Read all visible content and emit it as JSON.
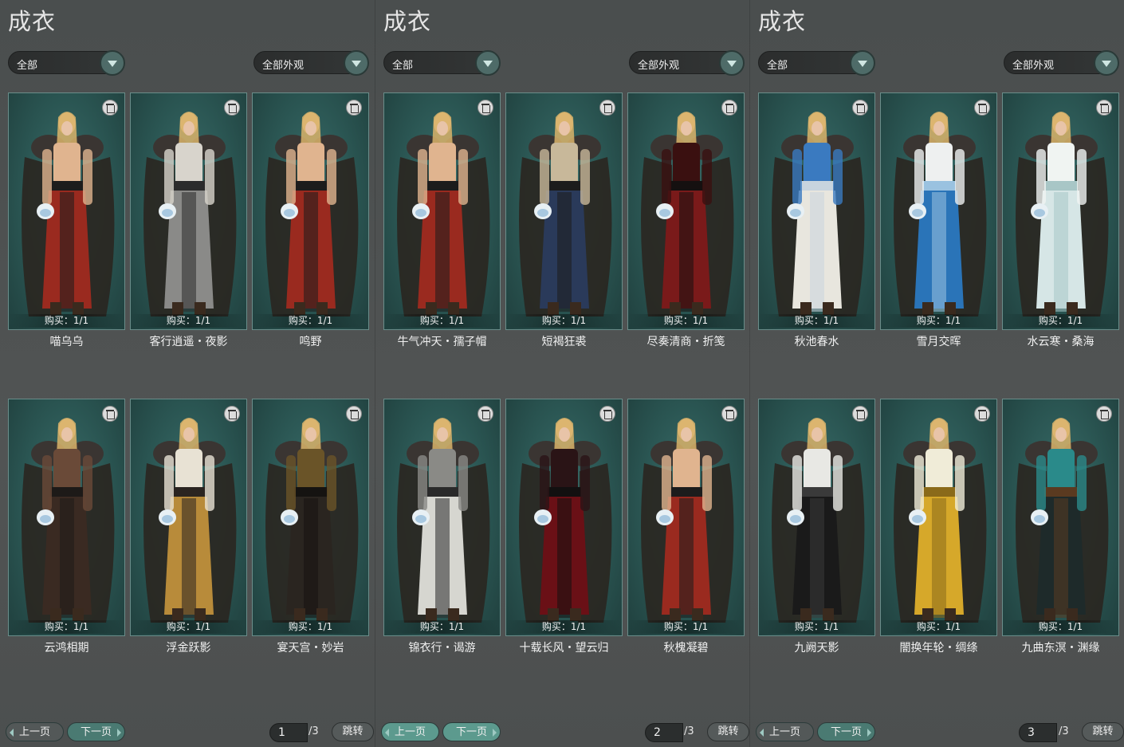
{
  "panels": [
    {
      "title": "成衣",
      "filter_category": "全部",
      "filter_appearance": "全部外观",
      "items": [
        {
          "name": "喵乌乌",
          "buy": "购买：1/1",
          "palette": [
            "#9a2a1f",
            "#e0b48f",
            "#1c1c1c"
          ]
        },
        {
          "name": "客行逍遥・夜影",
          "buy": "购买：1/1",
          "palette": [
            "#8a8a88",
            "#d8d4cc",
            "#2b2b2b"
          ]
        },
        {
          "name": "鸣野",
          "buy": "购买：1/1",
          "palette": [
            "#9a2a1f",
            "#e0b48f",
            "#1c1c1c"
          ]
        },
        {
          "name": "云鸿相期",
          "buy": "购买：1/1",
          "palette": [
            "#3a2a22",
            "#6a4a38",
            "#1d1a18"
          ]
        },
        {
          "name": "浮金跃影",
          "buy": "购买：1/1",
          "palette": [
            "#b88b3a",
            "#e8e2d4",
            "#2a2420"
          ]
        },
        {
          "name": "宴天宫・妙岩",
          "buy": "购买：1/1",
          "palette": [
            "#2a2520",
            "#6a5428",
            "#151311"
          ]
        }
      ],
      "pagination": {
        "prev": "上一页",
        "next": "下一页",
        "current": "1",
        "total": "/3",
        "jump": "跳转"
      }
    },
    {
      "title": "成衣",
      "filter_category": "全部",
      "filter_appearance": "全部外观",
      "items": [
        {
          "name": "牛气冲天・孺子帽",
          "buy": "购买：1/1",
          "palette": [
            "#9a2a1f",
            "#e0b48f",
            "#1c1c1c"
          ]
        },
        {
          "name": "短褐狂裘",
          "buy": "购买：1/1",
          "palette": [
            "#2a3a5a",
            "#c8b89a",
            "#1c1c1c"
          ]
        },
        {
          "name": "尽奏清商・折笺",
          "buy": "购买：1/1",
          "palette": [
            "#7a1a1a",
            "#3a1010",
            "#151010"
          ]
        },
        {
          "name": "锦衣行・谒游",
          "buy": "购买：1/1",
          "palette": [
            "#d6d6d0",
            "#8a8a86",
            "#2a2a2a"
          ]
        },
        {
          "name": "十载长风・望云归",
          "buy": "购买：1/1",
          "palette": [
            "#6a1016",
            "#2a1416",
            "#121010"
          ]
        },
        {
          "name": "秋槐凝碧",
          "buy": "购买：1/1",
          "palette": [
            "#9a2a1f",
            "#e0b48f",
            "#1c1c1c"
          ]
        }
      ],
      "pagination": {
        "prev": "上一页",
        "next": "下一页",
        "current": "2",
        "total": "/3",
        "jump": "跳转"
      }
    },
    {
      "title": "成衣",
      "filter_category": "全部",
      "filter_appearance": "全部外观",
      "items": [
        {
          "name": "秋池春水",
          "buy": "购买：1/1",
          "palette": [
            "#e8e6de",
            "#3a7ac0",
            "#c8d4de"
          ]
        },
        {
          "name": "雪月交晖",
          "buy": "购买：1/1",
          "palette": [
            "#2a74b8",
            "#eef0f0",
            "#9ac2e0"
          ]
        },
        {
          "name": "水云寒・桑海",
          "buy": "购买：1/1",
          "palette": [
            "#d6e6e6",
            "#f0f4f2",
            "#a8c6c6"
          ]
        },
        {
          "name": "九阙天影",
          "buy": "购买：1/1",
          "palette": [
            "#1a1a1a",
            "#e8e8e4",
            "#3a3a3a"
          ]
        },
        {
          "name": "闇换年轮・绸绦",
          "buy": "购买：1/1",
          "palette": [
            "#d6a82a",
            "#f0ecd8",
            "#8a6a1a"
          ]
        },
        {
          "name": "九曲东溟・渊缘",
          "buy": "购买：1/1",
          "palette": [
            "#1e2a2a",
            "#2a8a8a",
            "#5a3a20"
          ]
        }
      ],
      "pagination": {
        "prev": "上一页",
        "next": "下一页",
        "current": "3",
        "total": "/3",
        "jump": "跳转"
      }
    }
  ]
}
